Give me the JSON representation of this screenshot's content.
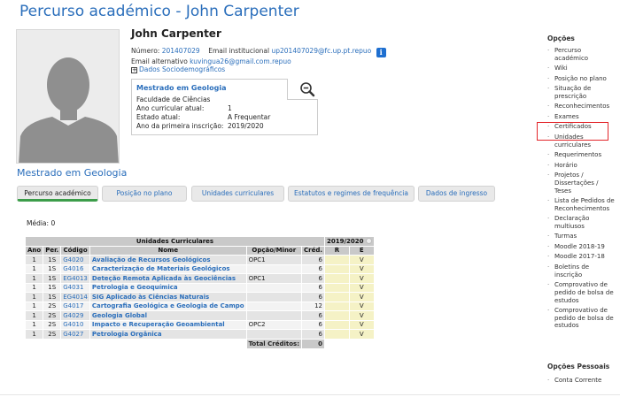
{
  "page": {
    "title": "Percurso académico - John Carpenter"
  },
  "profile": {
    "name": "John Carpenter",
    "numero_label": "Número:",
    "numero": "201407029",
    "email_inst_label": "Email institucional",
    "email_inst": "up201407029@fc.up.pt.repuo",
    "info_icon": "i",
    "email_alt_label": "Email alternativo",
    "email_alt": "kuvingua26@gmail.com.repuo",
    "socio_label": "Dados Sociodemográficos",
    "socio_icon": "plus-box-icon"
  },
  "program": {
    "title": "Mestrado em Geologia",
    "faculty": "Faculdade de Ciências",
    "rows": [
      {
        "label": "Ano curricular atual:",
        "value": "1"
      },
      {
        "label": "Estado atual:",
        "value": "A Frequentar"
      },
      {
        "label": "Ano da primeira inscrição:",
        "value": "2019/2020"
      }
    ],
    "zoom_icon": "magnifier-minus-icon"
  },
  "section_title": "Mestrado em Geologia",
  "tabs": [
    {
      "label": "Percurso académico",
      "active": true
    },
    {
      "label": "Posição no plano",
      "active": false
    },
    {
      "label": "Unidades curriculares",
      "active": false
    },
    {
      "label": "Estatutos e regimes de frequência",
      "active": false
    },
    {
      "label": "Dados de ingresso",
      "active": false
    }
  ],
  "media": {
    "label": "Média:",
    "value": "0"
  },
  "table": {
    "group_header": "Unidades Curriculares",
    "year_header": "2019/2020",
    "columns": [
      "Ano",
      "Per.",
      "Código",
      "Nome",
      "Opção/Minor",
      "Créd.",
      "R",
      "E"
    ],
    "rows": [
      {
        "ano": "1",
        "per": "1S",
        "codigo": "G4020",
        "nome": "Avaliação de Recursos Geológicos",
        "opcao": "OPC1",
        "cred": "6",
        "r": "",
        "e": "V"
      },
      {
        "ano": "1",
        "per": "1S",
        "codigo": "G4016",
        "nome": "Caracterização de Materiais Geológicos",
        "opcao": "",
        "cred": "6",
        "r": "",
        "e": "V"
      },
      {
        "ano": "1",
        "per": "1S",
        "codigo": "EG4013",
        "nome": "Deteção Remota Aplicada às Geociências",
        "opcao": "OPC1",
        "cred": "6",
        "r": "",
        "e": "V"
      },
      {
        "ano": "1",
        "per": "1S",
        "codigo": "G4031",
        "nome": "Petrologia e Geoquímica",
        "opcao": "",
        "cred": "6",
        "r": "",
        "e": "V"
      },
      {
        "ano": "1",
        "per": "1S",
        "codigo": "EG4014",
        "nome": "SIG Aplicado às Ciências Naturais",
        "opcao": "",
        "cred": "6",
        "r": "",
        "e": "V"
      },
      {
        "ano": "1",
        "per": "2S",
        "codigo": "G4017",
        "nome": "Cartografia Geológica e Geologia de Campo",
        "opcao": "",
        "cred": "12",
        "r": "",
        "e": "V"
      },
      {
        "ano": "1",
        "per": "2S",
        "codigo": "G4029",
        "nome": "Geologia Global",
        "opcao": "",
        "cred": "6",
        "r": "",
        "e": "V"
      },
      {
        "ano": "1",
        "per": "2S",
        "codigo": "G4010",
        "nome": "Impacto e Recuperação Geoambiental",
        "opcao": "OPC2",
        "cred": "6",
        "r": "",
        "e": "V"
      },
      {
        "ano": "1",
        "per": "2S",
        "codigo": "G4027",
        "nome": "Petrologia Orgânica",
        "opcao": "",
        "cred": "6",
        "r": "",
        "e": "V"
      }
    ],
    "total_label": "Total Créditos:",
    "total_value": "0"
  },
  "sidebar": {
    "opcoes_title": "Opções",
    "items": [
      "Percurso académico",
      "Wiki",
      "Posição no plano",
      "Situação de prescrição",
      "Reconhecimentos",
      "Exames",
      "Certificados",
      "Unidades curriculares",
      "Requerimentos",
      "Horário",
      "Projetos / Dissertações / Teses",
      "Lista de Pedidos de Reconhecimentos",
      "Declaração multiusos",
      "Turmas",
      "Moodle 2018-19",
      "Moodle 2017-18",
      "Boletins de inscrição",
      "Comprovativo de pedido de bolsa de estudos",
      "Comprovativo de pedido de bolsa de estudos"
    ],
    "pessoais_title": "Opções Pessoais",
    "pessoais_items": [
      "Conta Corrente"
    ],
    "highlight_color": "#e3262b"
  }
}
